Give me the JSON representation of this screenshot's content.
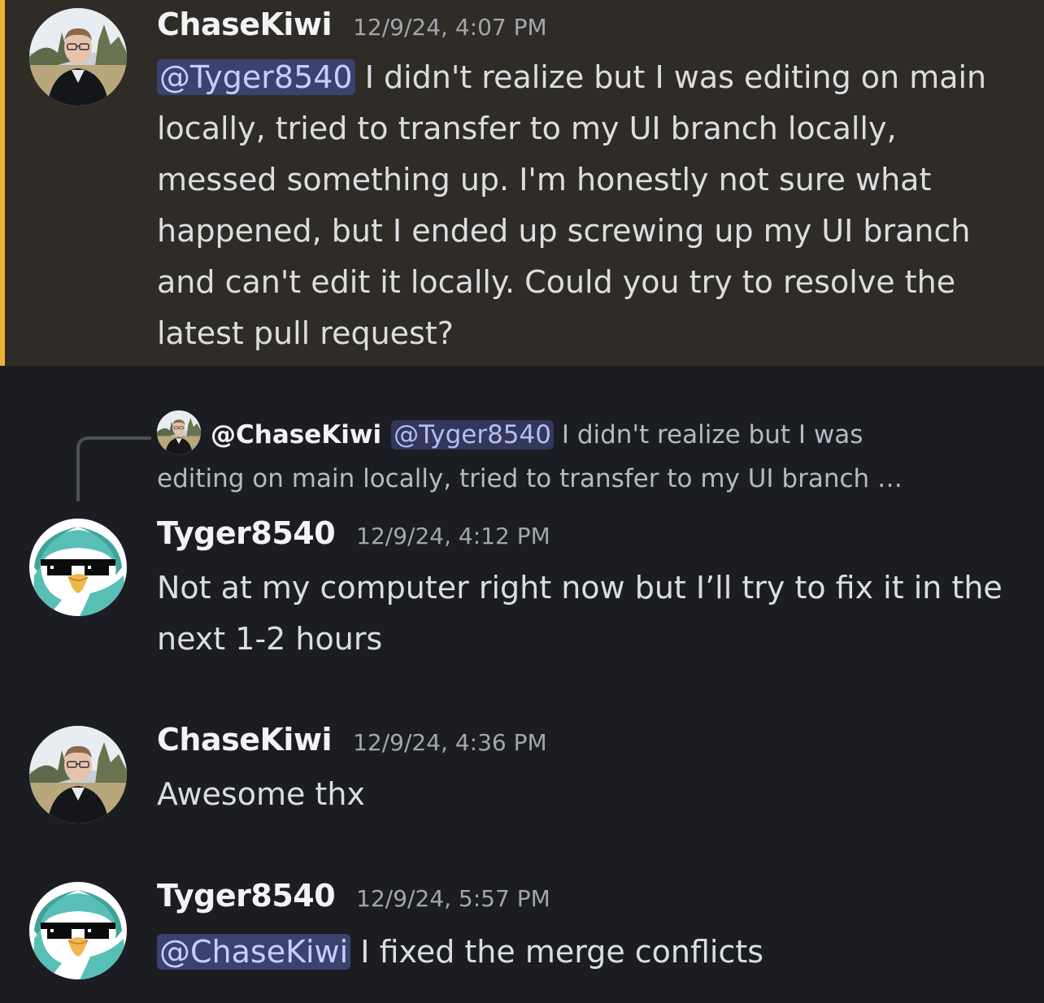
{
  "messages": [
    {
      "author": "ChaseKiwi",
      "timestamp": "12/9/24, 4:07 PM",
      "mention": "@Tyger8540",
      "text": " I didn't realize but I was editing on main locally, tried to transfer to my UI branch locally, messed something up. I'm honestly not sure what happened, but I ended up screwing up my UI branch and can't edit it locally. Could you try to resolve the latest pull request?",
      "avatar_icon": "person-photo-avatar"
    },
    {
      "reply": {
        "author": "@ChaseKiwi",
        "mention": "@Tyger8540",
        "text_line1": " I didn't realize but I was",
        "text_line2": "editing on main locally, tried to transfer to my UI branch …"
      },
      "author": "Tyger8540",
      "timestamp": "12/9/24, 4:12 PM",
      "text": "Not at my computer right now but I’ll try to fix it in the next 1-2 hours",
      "avatar_icon": "penguin-sunglasses-avatar"
    },
    {
      "author": "ChaseKiwi",
      "timestamp": "12/9/24, 4:36 PM",
      "text": "Awesome thx",
      "avatar_icon": "person-photo-avatar"
    },
    {
      "author": "Tyger8540",
      "timestamp": "12/9/24, 5:57 PM",
      "mention": "@ChaseKiwi",
      "text": " I fixed the merge conflicts",
      "avatar_icon": "penguin-sunglasses-avatar"
    }
  ],
  "colors": {
    "background": "#1c1d22",
    "highlight_bg": "#2f2c27",
    "highlight_bar": "#f0b232",
    "mention_bg": "#3c4270",
    "mention_text": "#c9cdfb"
  }
}
